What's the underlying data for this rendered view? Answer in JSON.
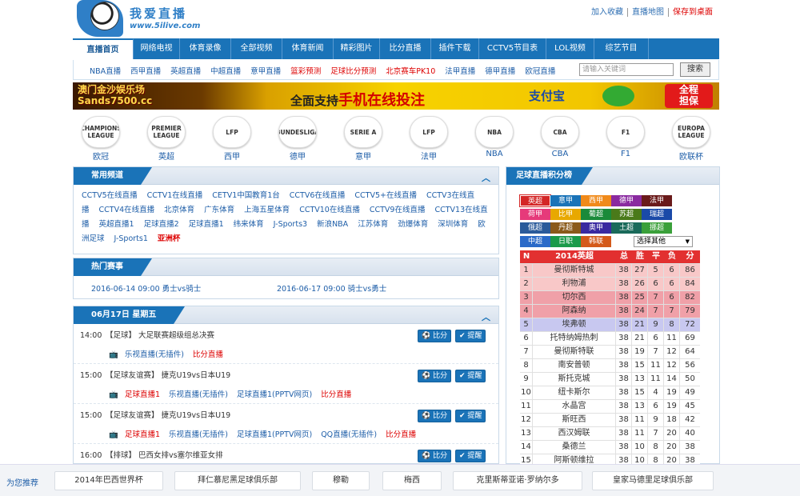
{
  "logo": {
    "title": "我爱直播",
    "url": "www.5ilive.com"
  },
  "toplinks": [
    "加入收藏",
    "直播地图",
    "保存到桌面"
  ],
  "nav": [
    {
      "label": "直播首页",
      "active": true
    },
    {
      "label": "网络电视"
    },
    {
      "label": "体育录像"
    },
    {
      "label": "全部视频"
    },
    {
      "label": "体育新闻"
    },
    {
      "label": "精彩图片"
    },
    {
      "label": "比分直播"
    },
    {
      "label": "插件下载"
    },
    {
      "label": "CCTV5节目表"
    },
    {
      "label": "LOL视频"
    },
    {
      "label": "综艺节目"
    }
  ],
  "subnav": [
    {
      "label": "NBA直播"
    },
    {
      "label": "西甲直播"
    },
    {
      "label": "英超直播"
    },
    {
      "label": "中超直播"
    },
    {
      "label": "意甲直播"
    },
    {
      "label": "篮彩预测",
      "red": true
    },
    {
      "label": "足球比分预测",
      "red": true
    },
    {
      "label": "北京赛车PK10",
      "red": true
    },
    {
      "label": "法甲直播"
    },
    {
      "label": "德甲直播"
    },
    {
      "label": "欧冠直播"
    }
  ],
  "search": {
    "placeholder": "请输入关键词",
    "button": "搜索"
  },
  "banner": {
    "left_line1": "澳门金沙娱乐场",
    "left_line2": "Sands7500.cc",
    "mid_prefix": "全面支持",
    "mid_highlight": "手机在线投注",
    "alipay": "支付宝",
    "badge_line1": "全程",
    "badge_line2": "担保"
  },
  "leagues": [
    {
      "logo": "CHAMPIONS LEAGUE",
      "name": "欧冠"
    },
    {
      "logo": "PREMIER LEAGUE",
      "name": "英超"
    },
    {
      "logo": "LFP",
      "name": "西甲"
    },
    {
      "logo": "BUNDESLIGA",
      "name": "德甲"
    },
    {
      "logo": "SERIE A",
      "name": "意甲"
    },
    {
      "logo": "LFP",
      "name": "法甲"
    },
    {
      "logo": "NBA",
      "name": "NBA"
    },
    {
      "logo": "CBA",
      "name": "CBA"
    },
    {
      "logo": "F1",
      "name": "F1"
    },
    {
      "logo": "EUROPA LEAGUE",
      "name": "欧联杯"
    }
  ],
  "channels_panel": {
    "title": "常用频道",
    "items": [
      {
        "label": "CCTV5在线直播"
      },
      {
        "label": "CCTV1在线直播"
      },
      {
        "label": "CETV1中国教育1台"
      },
      {
        "label": "CCTV6在线直播"
      },
      {
        "label": "CCTV5+在线直播"
      },
      {
        "label": "CCTV3在线直播"
      },
      {
        "label": "CCTV4在线直播"
      },
      {
        "label": "北京体育"
      },
      {
        "label": "广东体育"
      },
      {
        "label": "上海五星体育"
      },
      {
        "label": "CCTV10在线直播"
      },
      {
        "label": "CCTV9在线直播"
      },
      {
        "label": "CCTV13在线直播"
      },
      {
        "label": "英超直播1"
      },
      {
        "label": "足球直播2"
      },
      {
        "label": "足球直播1"
      },
      {
        "label": "纬来体育"
      },
      {
        "label": "J-Sports3"
      },
      {
        "label": "新浪NBA"
      },
      {
        "label": "江苏体育"
      },
      {
        "label": "劲爆体育"
      },
      {
        "label": "深圳体育"
      },
      {
        "label": "欧洲足球"
      },
      {
        "label": "J-Sports1"
      },
      {
        "label": "亚洲杯",
        "red": true
      }
    ]
  },
  "hot_panel": {
    "title": "热门赛事",
    "items": [
      "2016-06-14 09:00 勇士vs骑士",
      "2016-06-17 09:00 骑士vs勇士"
    ]
  },
  "schedule_panel": {
    "title": "06月17日 星期五",
    "score_btn": "比分",
    "remind_btn": "提醒",
    "matches": [
      {
        "time": "14:00",
        "title": "【足球】 大足联赛超级组总决赛",
        "links": [
          {
            "label": "乐视直播(无插件)"
          },
          {
            "label": "比分直播",
            "red": true
          }
        ]
      },
      {
        "time": "15:00",
        "title": "【足球友谊赛】 捷克U19vs日本U19",
        "links": [
          {
            "label": "足球直播1",
            "red": true
          },
          {
            "label": "乐视直播(无插件)"
          },
          {
            "label": "足球直播1(PPTV网页)"
          },
          {
            "label": "比分直播",
            "red": true
          }
        ]
      },
      {
        "time": "15:00",
        "title": "【足球友谊赛】 捷克U19vs日本U19",
        "links": [
          {
            "label": "足球直播1",
            "red": true
          },
          {
            "label": "乐视直播(无插件)"
          },
          {
            "label": "足球直播1(PPTV网页)"
          },
          {
            "label": "QQ直播(无插件)"
          },
          {
            "label": "比分直播",
            "red": true
          }
        ]
      },
      {
        "time": "16:00",
        "title": "【排球】 巴西女排vs塞尔维亚女排",
        "links": []
      }
    ]
  },
  "standings_panel": {
    "title": "足球直播积分榜",
    "leagues": [
      {
        "label": "英超",
        "color": "#d42626"
      },
      {
        "label": "意甲",
        "color": "#1a73b8"
      },
      {
        "label": "西甲",
        "color": "#f08a1a"
      },
      {
        "label": "德甲",
        "color": "#8a2aa0"
      },
      {
        "label": "法甲",
        "color": "#6a1a1a"
      },
      {
        "label": "荷甲",
        "color": "#e63a7a"
      },
      {
        "label": "比甲",
        "color": "#e8a800"
      },
      {
        "label": "葡超",
        "color": "#1a8a3a"
      },
      {
        "label": "苏超",
        "color": "#4a7a1a"
      },
      {
        "label": "瑞超",
        "color": "#1a4aa8"
      },
      {
        "label": "俄超",
        "color": "#2a5a9a"
      },
      {
        "label": "丹超",
        "color": "#8a5a1a"
      },
      {
        "label": "奥甲",
        "color": "#3a2aa0"
      },
      {
        "label": "土超",
        "color": "#1a6a5a"
      },
      {
        "label": "挪超",
        "color": "#3aa03a"
      },
      {
        "label": "中超",
        "color": "#2a6ac8"
      },
      {
        "label": "日职",
        "color": "#1a9a4a"
      },
      {
        "label": "韩联",
        "color": "#d45a1a"
      }
    ],
    "select_label": "选择其他",
    "table_headers": [
      "N",
      "2014英超",
      "总",
      "胜",
      "平",
      "负",
      "分"
    ],
    "rows": [
      [
        "1",
        "曼彻斯特城",
        "38",
        "27",
        "5",
        "6",
        "86"
      ],
      [
        "2",
        "利物浦",
        "38",
        "26",
        "6",
        "6",
        "84"
      ],
      [
        "3",
        "切尔西",
        "38",
        "25",
        "7",
        "6",
        "82"
      ],
      [
        "4",
        "阿森纳",
        "38",
        "24",
        "7",
        "7",
        "79"
      ],
      [
        "5",
        "埃弗顿",
        "38",
        "21",
        "9",
        "8",
        "72"
      ],
      [
        "6",
        "托特纳姆热刺",
        "38",
        "21",
        "6",
        "11",
        "69"
      ],
      [
        "7",
        "曼彻斯特联",
        "38",
        "19",
        "7",
        "12",
        "64"
      ],
      [
        "8",
        "南安普顿",
        "38",
        "15",
        "11",
        "12",
        "56"
      ],
      [
        "9",
        "斯托克城",
        "38",
        "13",
        "11",
        "14",
        "50"
      ],
      [
        "10",
        "纽卡斯尔",
        "38",
        "15",
        "4",
        "19",
        "49"
      ],
      [
        "11",
        "水晶宫",
        "38",
        "13",
        "6",
        "19",
        "45"
      ],
      [
        "12",
        "斯旺西",
        "38",
        "11",
        "9",
        "18",
        "42"
      ],
      [
        "13",
        "西汉姆联",
        "38",
        "11",
        "7",
        "20",
        "40"
      ],
      [
        "14",
        "桑德兰",
        "38",
        "10",
        "8",
        "20",
        "38"
      ],
      [
        "15",
        "阿斯顿维拉",
        "38",
        "10",
        "8",
        "20",
        "38"
      ]
    ]
  },
  "recommend": {
    "label": "为您推荐",
    "items": [
      "2014年巴西世界杯",
      "拜仁慕尼黑足球俱乐部",
      "穆勒",
      "梅西",
      "克里斯蒂亚诺·罗纳尔多",
      "皇家马德里足球俱乐部"
    ]
  }
}
